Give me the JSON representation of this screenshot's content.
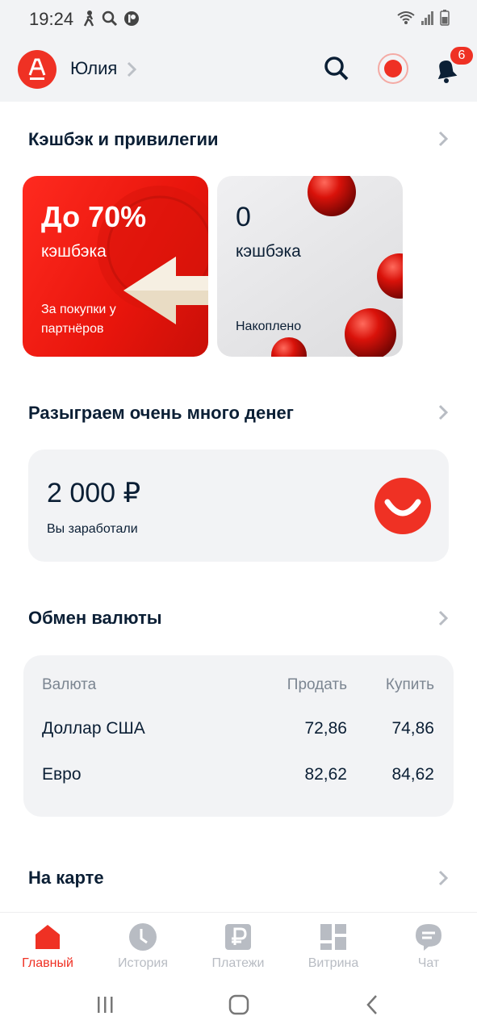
{
  "status_bar": {
    "time": "19:24"
  },
  "header": {
    "user_name": "Юлия",
    "notifications_count": "6"
  },
  "cashback": {
    "title": "Кэшбэк и привилегии",
    "partner_card": {
      "headline": "До 70%",
      "subtitle": "кэшбэка",
      "note": "За покупки у партнёров"
    },
    "accumulated_card": {
      "value": "0",
      "subtitle": "кэшбэка",
      "note": "Накоплено"
    }
  },
  "lottery": {
    "title": "Разыграем очень много денег",
    "amount": "2 000 ₽",
    "label": "Вы заработали"
  },
  "currency": {
    "title": "Обмен валюты",
    "columns": [
      "Валюта",
      "Продать",
      "Купить"
    ],
    "rows": [
      {
        "name": "Доллар США",
        "sell": "72,86",
        "buy": "74,86"
      },
      {
        "name": "Евро",
        "sell": "82,62",
        "buy": "84,62"
      }
    ]
  },
  "map": {
    "title": "На карте"
  },
  "nav": {
    "items": [
      {
        "label": "Главный",
        "icon": "home-icon"
      },
      {
        "label": "История",
        "icon": "clock-icon"
      },
      {
        "label": "Платежи",
        "icon": "ruble-icon"
      },
      {
        "label": "Витрина",
        "icon": "showcase-icon"
      },
      {
        "label": "Чат",
        "icon": "chat-icon"
      }
    ]
  },
  "colors": {
    "brand_red": "#ef3124",
    "text_dark": "#0b1f35",
    "muted": "#b8bcc3",
    "card_bg": "#f2f3f5"
  }
}
